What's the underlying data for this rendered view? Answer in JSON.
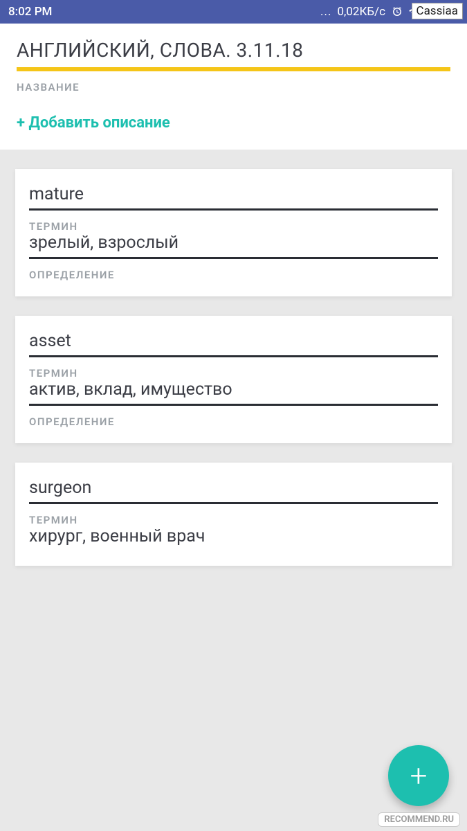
{
  "status": {
    "time": "8:02 PM",
    "dots": "...",
    "speed": "0,02КБ/с"
  },
  "header": {
    "title": "АНГЛИЙСКИЙ, СЛОВА. 3.11.18",
    "title_label": "НАЗВАНИЕ",
    "add_description": "+ Добавить описание"
  },
  "labels": {
    "term": "ТЕРМИН",
    "definition": "ОПРЕДЕЛЕНИЕ"
  },
  "cards": [
    {
      "term": "mature",
      "definition": "зрелый, взрослый"
    },
    {
      "term": "asset",
      "definition": "актив, вклад, имущество"
    },
    {
      "term": "surgeon",
      "definition": "хирург, военный врач"
    }
  ],
  "fab": {
    "glyph": "+"
  },
  "watermark": {
    "text": "RECOMMEND.RU",
    "top": "Cassiaa"
  }
}
